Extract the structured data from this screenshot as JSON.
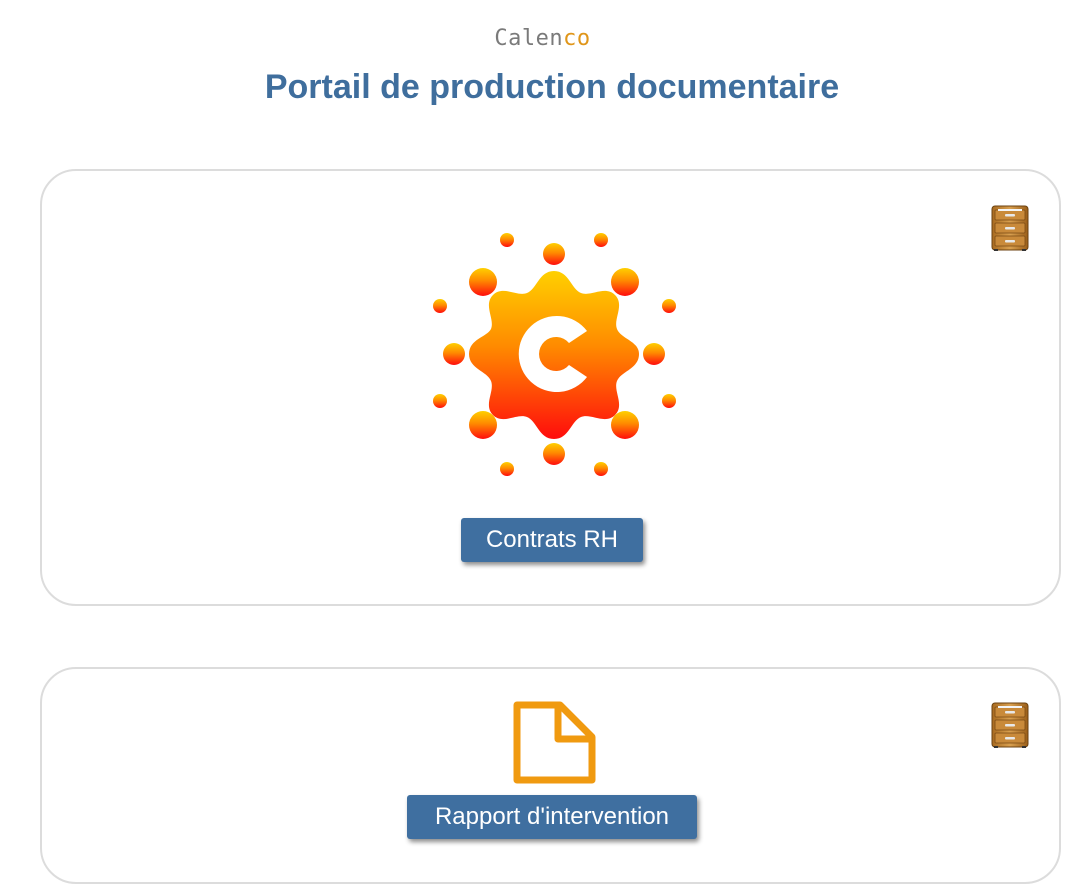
{
  "header": {
    "brand_main": "Calen",
    "brand_accent": "co",
    "title": "Portail de production documentaire"
  },
  "cards": [
    {
      "button_label": "Contrats RH",
      "icon": "calenco-sun-logo-icon",
      "corner_icon": "filing-cabinet-icon"
    },
    {
      "button_label": "Rapport d'intervention",
      "icon": "document-icon",
      "corner_icon": "filing-cabinet-icon"
    }
  ],
  "colors": {
    "title": "#3f6e9d",
    "button": "#3f6fa0",
    "accent_orange": "#e0961a",
    "card_border": "#dcdcdc"
  }
}
